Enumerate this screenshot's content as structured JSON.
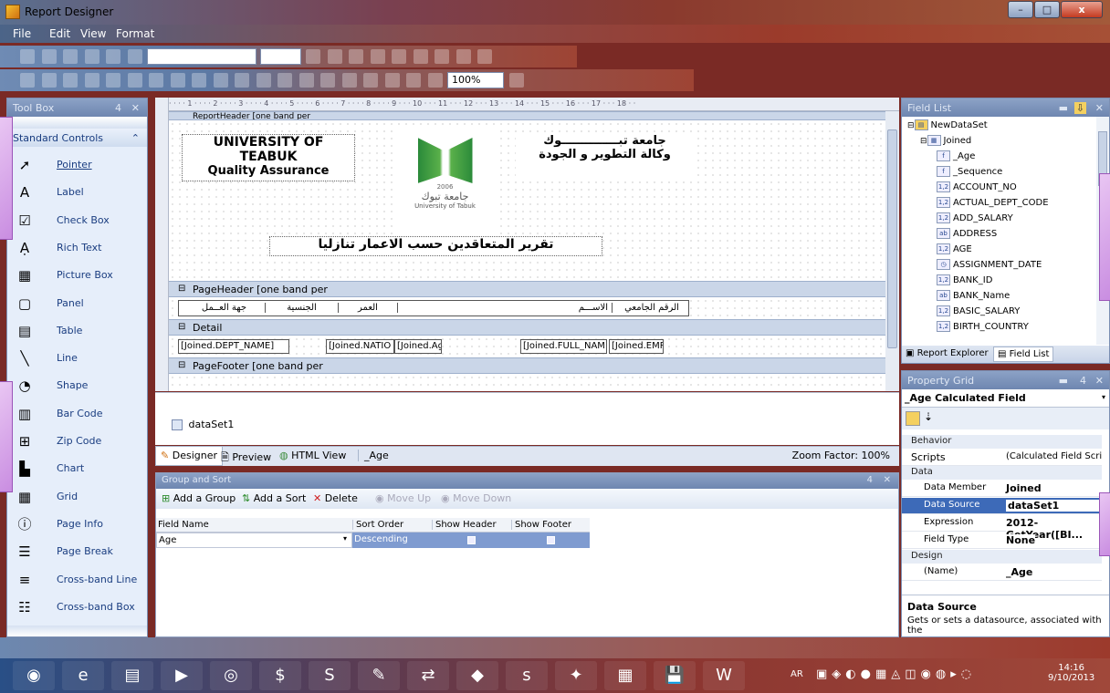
{
  "window": {
    "title": "Report Designer",
    "min": "–",
    "max": "□",
    "close": "x"
  },
  "menu": [
    "File",
    "Edit",
    "View",
    "Format"
  ],
  "toolbar": {
    "zoom": "100%"
  },
  "toolbox": {
    "title": "Tool Box",
    "pin": "4",
    "close": "✕",
    "section": "Standard Controls",
    "items": [
      {
        "label": "Pointer",
        "icon": "pointer-icon",
        "glyph": "➚"
      },
      {
        "label": "Label",
        "icon": "label-icon",
        "glyph": "A"
      },
      {
        "label": "Check Box",
        "icon": "checkbox-icon",
        "glyph": "☑"
      },
      {
        "label": "Rich Text",
        "icon": "richtext-icon",
        "glyph": "Ạ"
      },
      {
        "label": "Picture Box",
        "icon": "picturebox-icon",
        "glyph": "▦"
      },
      {
        "label": "Panel",
        "icon": "panel-icon",
        "glyph": "▢"
      },
      {
        "label": "Table",
        "icon": "table-icon",
        "glyph": "▤"
      },
      {
        "label": "Line",
        "icon": "line-icon",
        "glyph": "╲"
      },
      {
        "label": "Shape",
        "icon": "shape-icon",
        "glyph": "◔"
      },
      {
        "label": "Bar Code",
        "icon": "barcode-icon",
        "glyph": "▥"
      },
      {
        "label": "Zip Code",
        "icon": "zipcode-icon",
        "glyph": "⊞"
      },
      {
        "label": "Chart",
        "icon": "chart-icon",
        "glyph": "▙"
      },
      {
        "label": "Grid",
        "icon": "grid-icon",
        "glyph": "▦"
      },
      {
        "label": "Page Info",
        "icon": "pageinfo-icon",
        "glyph": "ⓘ"
      },
      {
        "label": "Page Break",
        "icon": "pagebreak-icon",
        "glyph": "☰"
      },
      {
        "label": "Cross-band Line",
        "icon": "crossbandline-icon",
        "glyph": "≡"
      },
      {
        "label": "Cross-band Box",
        "icon": "crossbandbox-icon",
        "glyph": "☷"
      }
    ]
  },
  "designer": {
    "ruler": "· · · · 1 · · · · 2 · · · · 3 · · · · 4 · · · · 5 · · · · 6 · · · · 7 · · · · 8 · · · · 9 · · · 10 · · · 11 · · · 12 · · · 13 · · · 14 · · · 15 · · · 16 · · · 17 · · · 18 · ·",
    "report_header_band": "ReportHeader [one band per",
    "uni_en_1": "UNIVERSITY OF TEABUK",
    "uni_en_2": "Quality Assurance",
    "uni_ar_1": "جامعة تبــــــــــــــوك",
    "uni_ar_2": "وكالة التطوير و الجودة",
    "logo_ar": "جامعة تبوك",
    "logo_en": "University of Tabuk",
    "logo_year": "2006",
    "report_title": "تقرير المتعاقدين حسب الاعمار تنازليا",
    "page_header_band": "PageHeader [one band per",
    "col_headers": [
      "جهة العــمل",
      "الجنسية",
      "العمر",
      "الاســـم",
      "الرقم الجامعي"
    ],
    "detail_band": "Detail",
    "detail_fields": [
      "[Joined.DEPT_NAME]",
      "[Joined.NATIO",
      "[Joined.Ag",
      "[Joined.FULL_NAM",
      "[Joined.EMP"
    ],
    "page_footer_band": "PageFooter [one band per",
    "component": "dataSet1"
  },
  "tabs": {
    "designer": "Designer",
    "preview": "Preview",
    "html": "HTML View",
    "field": "_Age",
    "zoom_label": "Zoom Factor: 100%"
  },
  "groupsort": {
    "title": "Group and Sort",
    "add_group": "Add a Group",
    "add_sort": "Add a Sort",
    "delete": "Delete",
    "move_up": "Move Up",
    "move_down": "Move Down",
    "columns": [
      "Field Name",
      "Sort Order",
      "Show Header",
      "Show Footer"
    ],
    "row": {
      "field": "Age",
      "order": "Descending"
    }
  },
  "fieldlist": {
    "title": "Field List",
    "root": "NewDataSet",
    "table": "Joined",
    "fields": [
      {
        "name": "_Age",
        "type": "f"
      },
      {
        "name": "_Sequence",
        "type": "f"
      },
      {
        "name": "ACCOUNT_NO",
        "type": "1,2"
      },
      {
        "name": "ACTUAL_DEPT_CODE",
        "type": "1,2"
      },
      {
        "name": "ADD_SALARY",
        "type": "1,2"
      },
      {
        "name": "ADDRESS",
        "type": "ab"
      },
      {
        "name": "AGE",
        "type": "1,2"
      },
      {
        "name": "ASSIGNMENT_DATE",
        "type": "◷"
      },
      {
        "name": "BANK_ID",
        "type": "1,2"
      },
      {
        "name": "BANK_Name",
        "type": "ab"
      },
      {
        "name": "BASIC_SALARY",
        "type": "1,2"
      },
      {
        "name": "BIRTH_COUNTRY",
        "type": "1,2"
      }
    ],
    "tab_explorer": "Report Explorer",
    "tab_fieldlist": "Field List"
  },
  "propgrid": {
    "title": "Property Grid",
    "object": "_Age  Calculated Field",
    "cat_behavior": "Behavior",
    "scripts_label": "Scripts",
    "scripts_value": "(Calculated Field Scri...",
    "cat_data": "Data",
    "rows": [
      {
        "label": "Data Member",
        "value": "Joined"
      },
      {
        "label": "Data Source",
        "value": "dataSet1"
      },
      {
        "label": "Expression",
        "value": "2012-GetYear([BI..."
      },
      {
        "label": "Field Type",
        "value": "None"
      }
    ],
    "cat_design": "Design",
    "name_label": "(Name)",
    "name_value": "_Age",
    "desc_title": "Data Source",
    "desc_text": "Gets or sets a datasource, associated with the"
  },
  "taskbar": {
    "lang": "AR",
    "time": "14:16",
    "date": "9/10/2013",
    "apps": [
      "start-orb-icon",
      "ie-icon",
      "explorer-icon",
      "media-icon",
      "chrome-icon",
      "skype-dollar-icon",
      "skype-icon",
      "paint-icon",
      "teamviewer-icon",
      "app-icon",
      "file-s-icon",
      "photos-icon",
      "apps-icon",
      "save-icon",
      "word-icon"
    ]
  }
}
